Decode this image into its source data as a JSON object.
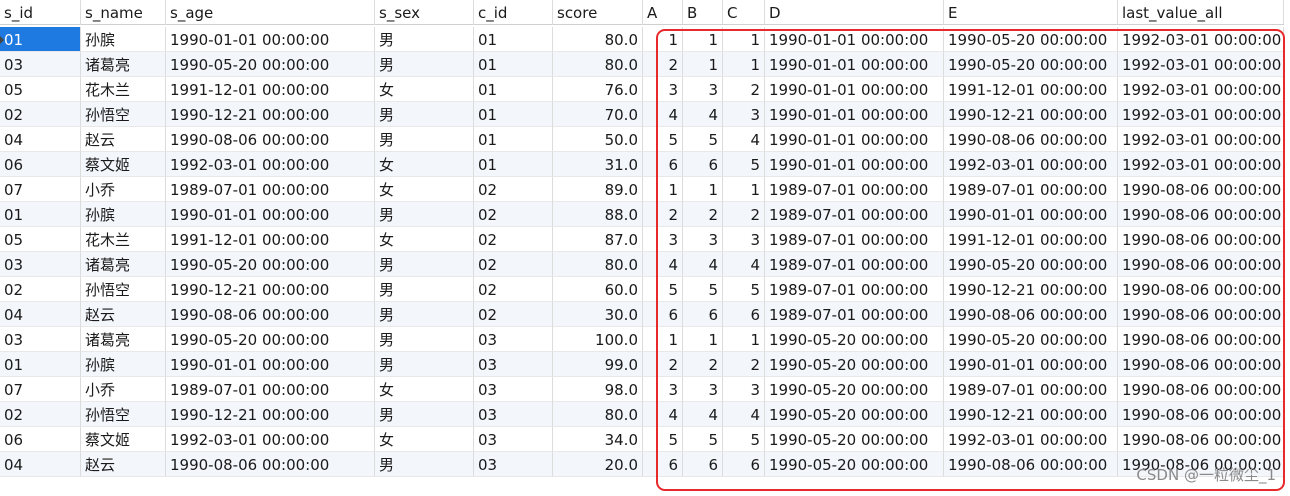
{
  "columns": [
    "s_id",
    "s_name",
    "s_age",
    "s_sex",
    "c_id",
    "score",
    "A",
    "B",
    "C",
    "D",
    "E",
    "last_value_all"
  ],
  "rows": [
    [
      "01",
      "孙膑",
      "1990-01-01 00:00:00",
      "男",
      "01",
      "80.0",
      "1",
      "1",
      "1",
      "1990-01-01 00:00:00",
      "1990-05-20 00:00:00",
      "1992-03-01 00:00:00"
    ],
    [
      "03",
      "诸葛亮",
      "1990-05-20 00:00:00",
      "男",
      "01",
      "80.0",
      "2",
      "1",
      "1",
      "1990-01-01 00:00:00",
      "1990-05-20 00:00:00",
      "1992-03-01 00:00:00"
    ],
    [
      "05",
      "花木兰",
      "1991-12-01 00:00:00",
      "女",
      "01",
      "76.0",
      "3",
      "3",
      "2",
      "1990-01-01 00:00:00",
      "1991-12-01 00:00:00",
      "1992-03-01 00:00:00"
    ],
    [
      "02",
      "孙悟空",
      "1990-12-21 00:00:00",
      "男",
      "01",
      "70.0",
      "4",
      "4",
      "3",
      "1990-01-01 00:00:00",
      "1990-12-21 00:00:00",
      "1992-03-01 00:00:00"
    ],
    [
      "04",
      "赵云",
      "1990-08-06 00:00:00",
      "男",
      "01",
      "50.0",
      "5",
      "5",
      "4",
      "1990-01-01 00:00:00",
      "1990-08-06 00:00:00",
      "1992-03-01 00:00:00"
    ],
    [
      "06",
      "蔡文姬",
      "1992-03-01 00:00:00",
      "女",
      "01",
      "31.0",
      "6",
      "6",
      "5",
      "1990-01-01 00:00:00",
      "1992-03-01 00:00:00",
      "1992-03-01 00:00:00"
    ],
    [
      "07",
      "小乔",
      "1989-07-01 00:00:00",
      "女",
      "02",
      "89.0",
      "1",
      "1",
      "1",
      "1989-07-01 00:00:00",
      "1989-07-01 00:00:00",
      "1990-08-06 00:00:00"
    ],
    [
      "01",
      "孙膑",
      "1990-01-01 00:00:00",
      "男",
      "02",
      "88.0",
      "2",
      "2",
      "2",
      "1989-07-01 00:00:00",
      "1990-01-01 00:00:00",
      "1990-08-06 00:00:00"
    ],
    [
      "05",
      "花木兰",
      "1991-12-01 00:00:00",
      "女",
      "02",
      "87.0",
      "3",
      "3",
      "3",
      "1989-07-01 00:00:00",
      "1991-12-01 00:00:00",
      "1990-08-06 00:00:00"
    ],
    [
      "03",
      "诸葛亮",
      "1990-05-20 00:00:00",
      "男",
      "02",
      "80.0",
      "4",
      "4",
      "4",
      "1989-07-01 00:00:00",
      "1990-05-20 00:00:00",
      "1990-08-06 00:00:00"
    ],
    [
      "02",
      "孙悟空",
      "1990-12-21 00:00:00",
      "男",
      "02",
      "60.0",
      "5",
      "5",
      "5",
      "1989-07-01 00:00:00",
      "1990-12-21 00:00:00",
      "1990-08-06 00:00:00"
    ],
    [
      "04",
      "赵云",
      "1990-08-06 00:00:00",
      "男",
      "02",
      "30.0",
      "6",
      "6",
      "6",
      "1989-07-01 00:00:00",
      "1990-08-06 00:00:00",
      "1990-08-06 00:00:00"
    ],
    [
      "03",
      "诸葛亮",
      "1990-05-20 00:00:00",
      "男",
      "03",
      "100.0",
      "1",
      "1",
      "1",
      "1990-05-20 00:00:00",
      "1990-05-20 00:00:00",
      "1990-08-06 00:00:00"
    ],
    [
      "01",
      "孙膑",
      "1990-01-01 00:00:00",
      "男",
      "03",
      "99.0",
      "2",
      "2",
      "2",
      "1990-05-20 00:00:00",
      "1990-01-01 00:00:00",
      "1990-08-06 00:00:00"
    ],
    [
      "07",
      "小乔",
      "1989-07-01 00:00:00",
      "女",
      "03",
      "98.0",
      "3",
      "3",
      "3",
      "1990-05-20 00:00:00",
      "1989-07-01 00:00:00",
      "1990-08-06 00:00:00"
    ],
    [
      "02",
      "孙悟空",
      "1990-12-21 00:00:00",
      "男",
      "03",
      "80.0",
      "4",
      "4",
      "4",
      "1990-05-20 00:00:00",
      "1990-12-21 00:00:00",
      "1990-08-06 00:00:00"
    ],
    [
      "06",
      "蔡文姬",
      "1992-03-01 00:00:00",
      "女",
      "03",
      "34.0",
      "5",
      "5",
      "5",
      "1990-05-20 00:00:00",
      "1992-03-01 00:00:00",
      "1990-08-06 00:00:00"
    ],
    [
      "04",
      "赵云",
      "1990-08-06 00:00:00",
      "男",
      "03",
      "20.0",
      "6",
      "6",
      "6",
      "1990-05-20 00:00:00",
      "1990-08-06 00:00:00",
      "1990-08-06 00:00:00"
    ]
  ],
  "selected_cell": {
    "row": 0,
    "col": 0
  },
  "highlight_color": "#e8292b",
  "selection_color": "#1e7ae0",
  "watermark": "CSDN @一粒微尘_1"
}
